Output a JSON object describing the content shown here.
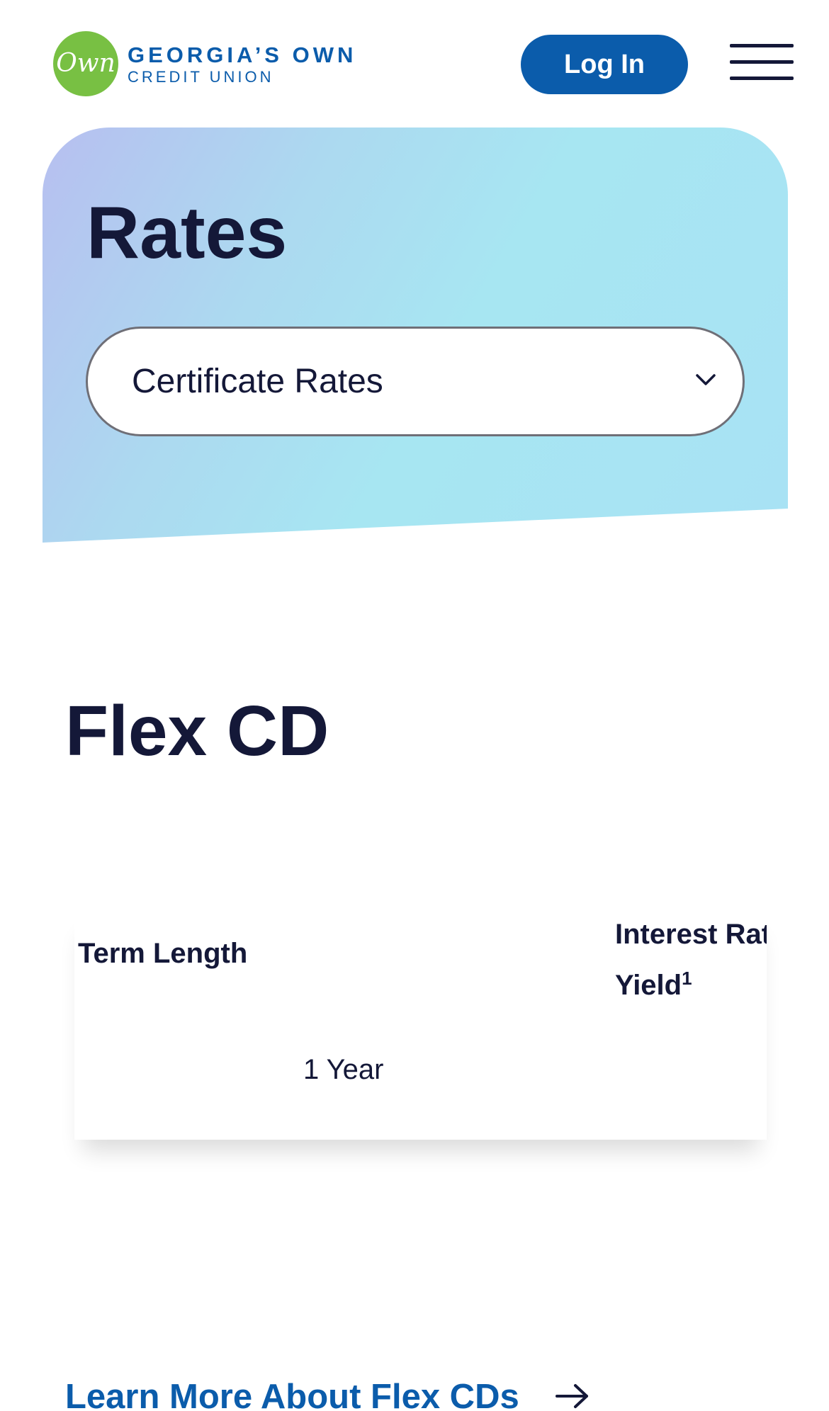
{
  "header": {
    "logo_badge_text": "Own",
    "logo_line1": "GEORGIA’S OWN",
    "logo_line2": "CREDIT UNION",
    "login_label": "Log In",
    "menu_icon": "hamburger-menu-icon"
  },
  "hero": {
    "title": "Rates",
    "select_value": "Certificate Rates",
    "select_icon": "chevron-down-icon"
  },
  "section": {
    "title": "Flex CD",
    "table": {
      "headers": {
        "term": "Term Length",
        "rate_line1": "Interest Rate",
        "rate_line2": "Yield",
        "rate_footnote": "1"
      },
      "rows": [
        {
          "term": "1 Year"
        }
      ]
    },
    "link_label": "Learn More About Flex CDs",
    "link_icon": "arrow-right-icon"
  },
  "colors": {
    "brand_blue": "#0b5cab",
    "brand_green": "#78c043",
    "heading_navy": "#141838"
  }
}
